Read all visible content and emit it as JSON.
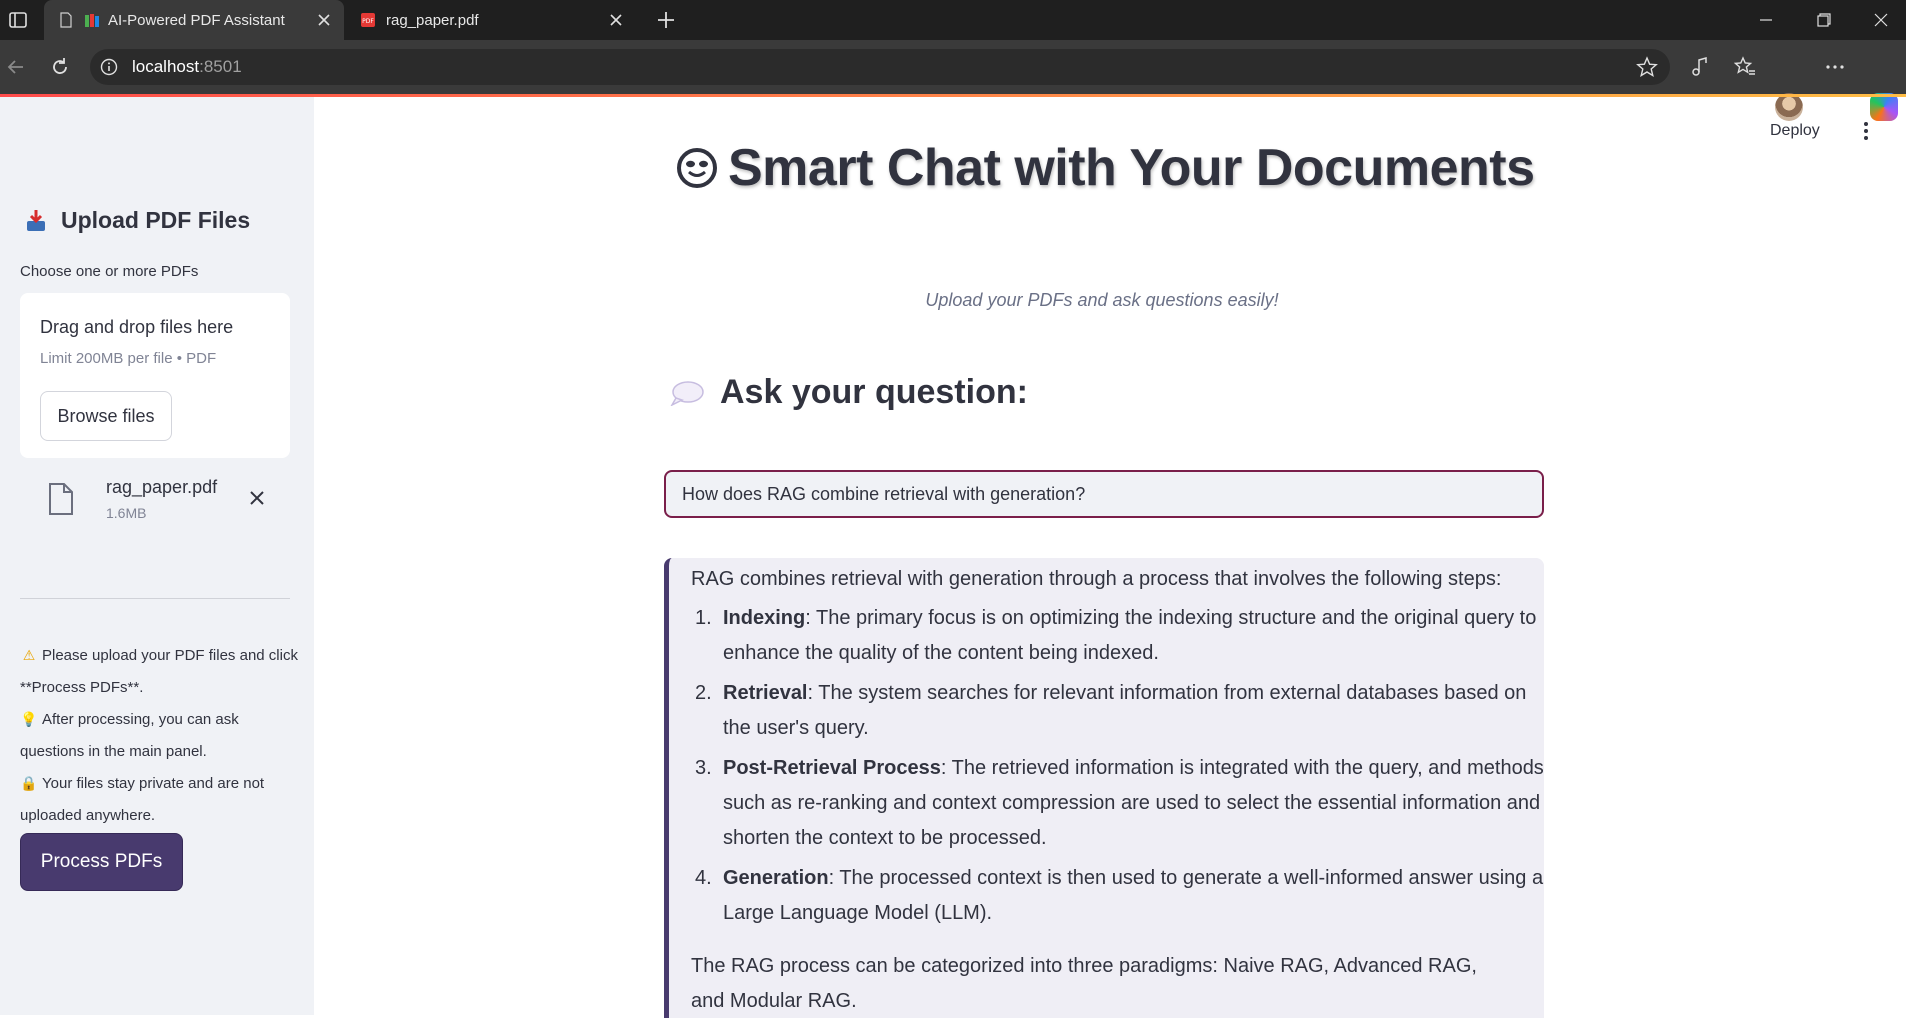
{
  "browser": {
    "tabs": [
      {
        "title": "AI-Powered PDF Assistant",
        "active": true
      },
      {
        "title": "rag_paper.pdf",
        "active": false
      }
    ],
    "url_host": "localhost",
    "url_port": ":8501"
  },
  "sidebar": {
    "header": "Upload PDF Files",
    "uploader_label": "Choose one or more PDFs",
    "dropzone": {
      "title": "Drag and drop files here",
      "limit": "Limit 200MB per file • PDF",
      "browse_label": "Browse files"
    },
    "file": {
      "name": "rag_paper.pdf",
      "size": "1.6MB"
    },
    "info": [
      {
        "icon": "warning-icon",
        "text": "Please upload your PDF files and click **Process PDFs**."
      },
      {
        "icon": "lightbulb-icon",
        "text": "After processing, you can ask questions in the main panel."
      },
      {
        "icon": "lock-icon",
        "text": "Your files stay private and are not uploaded anywhere."
      }
    ],
    "process_label": "Process PDFs"
  },
  "header": {
    "deploy_label": "Deploy"
  },
  "main": {
    "title": "Smart Chat with Your Documents",
    "subtitle": "Upload your PDFs and ask questions easily!",
    "ask_heading": "Ask your question:",
    "question_value": "How does RAG combine retrieval with generation?",
    "answer": {
      "intro": "RAG combines retrieval with generation through a process that involves the following steps:",
      "steps": [
        {
          "num": "1.",
          "term": "Indexing",
          "text": ": The primary focus is on optimizing the indexing structure and the original query to enhance the quality of the content being indexed."
        },
        {
          "num": "2.",
          "term": "Retrieval",
          "text": ": The system searches for relevant information from external databases based on the user's query."
        },
        {
          "num": "3.",
          "term": "Post-Retrieval Process",
          "text": ": The retrieved information is integrated with the query, and methods such as re-ranking and context compression are used to select the essential information and shorten the context to be processed."
        },
        {
          "num": "4.",
          "term": "Generation",
          "text": ": The processed context is then used to generate a well-informed answer using a Large Language Model (LLM)."
        }
      ],
      "outro": "The RAG process can be categorized into three paradigms: Naive RAG, Advanced RAG, and Modular RAG."
    }
  },
  "colors": {
    "accent": "#483a6e",
    "input_border": "#7a1f4a",
    "sidebar_bg": "#f0f2f6",
    "answer_bg": "#efeef5"
  }
}
